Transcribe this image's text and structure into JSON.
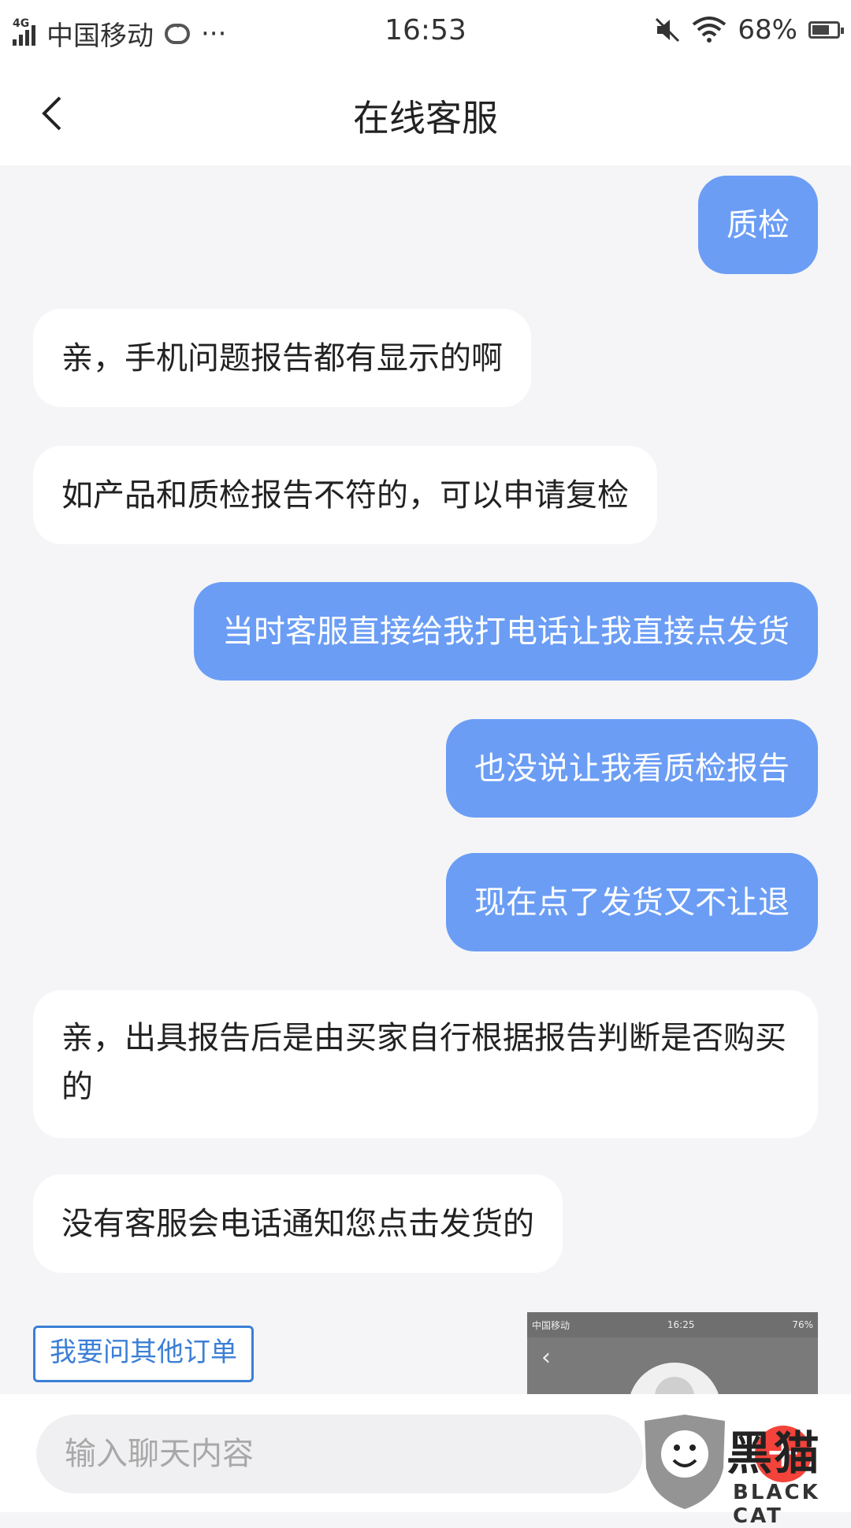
{
  "status_bar": {
    "network": "4G",
    "carrier": "中国移动",
    "more": "···",
    "time": "16:53",
    "battery": "68%"
  },
  "header": {
    "title": "在线客服"
  },
  "messages": [
    {
      "from": "me",
      "text": "质检"
    },
    {
      "from": "them",
      "text": "亲，手机问题报告都有显示的啊"
    },
    {
      "from": "them",
      "text": "如产品和质检报告不符的，可以申请复检"
    },
    {
      "from": "me",
      "text": "当时客服直接给我打电话让我直接点发货"
    },
    {
      "from": "me",
      "text": "也没说让我看质检报告"
    },
    {
      "from": "me",
      "text": "现在点了发货又不让退"
    },
    {
      "from": "them",
      "text": "亲，出具报告后是由买家自行根据报告判断是否购买的"
    },
    {
      "from": "them",
      "text": "没有客服会电话通知您点击发货的"
    }
  ],
  "quick_reply": "我要问其他订单",
  "thumbnail": {
    "carrier": "中国移动",
    "time": "16:25",
    "battery": "76%"
  },
  "input": {
    "placeholder": "输入聊天内容"
  },
  "plus_label": "+",
  "watermark": {
    "text": "黑猫",
    "subtext": "BLACK CAT"
  },
  "colors": {
    "my_bubble": "#6b9df5",
    "their_bubble": "#ffffff",
    "accent": "#3b7fd6"
  }
}
